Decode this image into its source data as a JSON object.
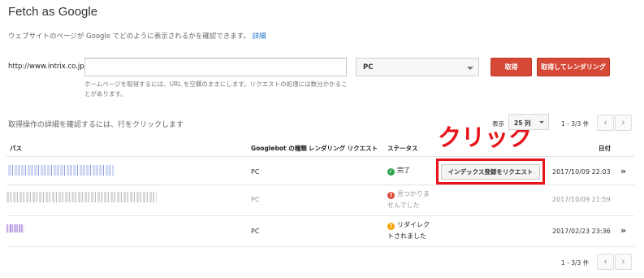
{
  "page": {
    "title": "Fetch as Google",
    "description": "ウェブサイトのページが Google でどのように表示されるかを確認できます。",
    "details_link": "詳細"
  },
  "form": {
    "url_prefix": "http://www.intrix.co.jp/",
    "url_value": "",
    "hint": "ホームページを取得するには、URL を空欄のままにします。リクエストの処理には数分かかることがあります。",
    "device_select": "PC",
    "fetch_button": "取得",
    "fetch_render_button": "取得してレンダリング"
  },
  "history": {
    "label": "取得操作の詳細を確認するには、行をクリックします",
    "show_label": "表示",
    "page_size": "25 列",
    "range_top": "1 - 3/3 件",
    "range_bottom": "1 - 3/3 件",
    "prev_icon": "chevron-left-icon",
    "next_icon": "chevron-right-icon"
  },
  "annotation": {
    "click_label": "クリック",
    "color": "#e8141a"
  },
  "table": {
    "headers": {
      "path": "パス",
      "googlebot_type": "Googlebot の種類",
      "rendering": "レンダリング リクエスト",
      "status": "ステータス",
      "date": "日付"
    },
    "rows": [
      {
        "type": "PC",
        "status_icon": "check-circle-icon",
        "status": "完了",
        "action": "インデックス登録をリクエスト",
        "date": "2017/10/09 22:03"
      },
      {
        "type": "PC",
        "status_icon": "error-circle-icon",
        "status_line1": "見つかりま",
        "status_line2": "せんでした",
        "date": "2017/10/09 21:59"
      },
      {
        "type": "PC",
        "status_icon": "warning-circle-icon",
        "status_line1": "リダイレク",
        "status_line2": "トされました",
        "date": "2017/02/23 23:36"
      }
    ]
  },
  "colors": {
    "primary_button": "#d64937",
    "link": "#1a73c8",
    "ok": "#2fa24d",
    "error": "#dd4b39",
    "warning": "#f4a300"
  }
}
